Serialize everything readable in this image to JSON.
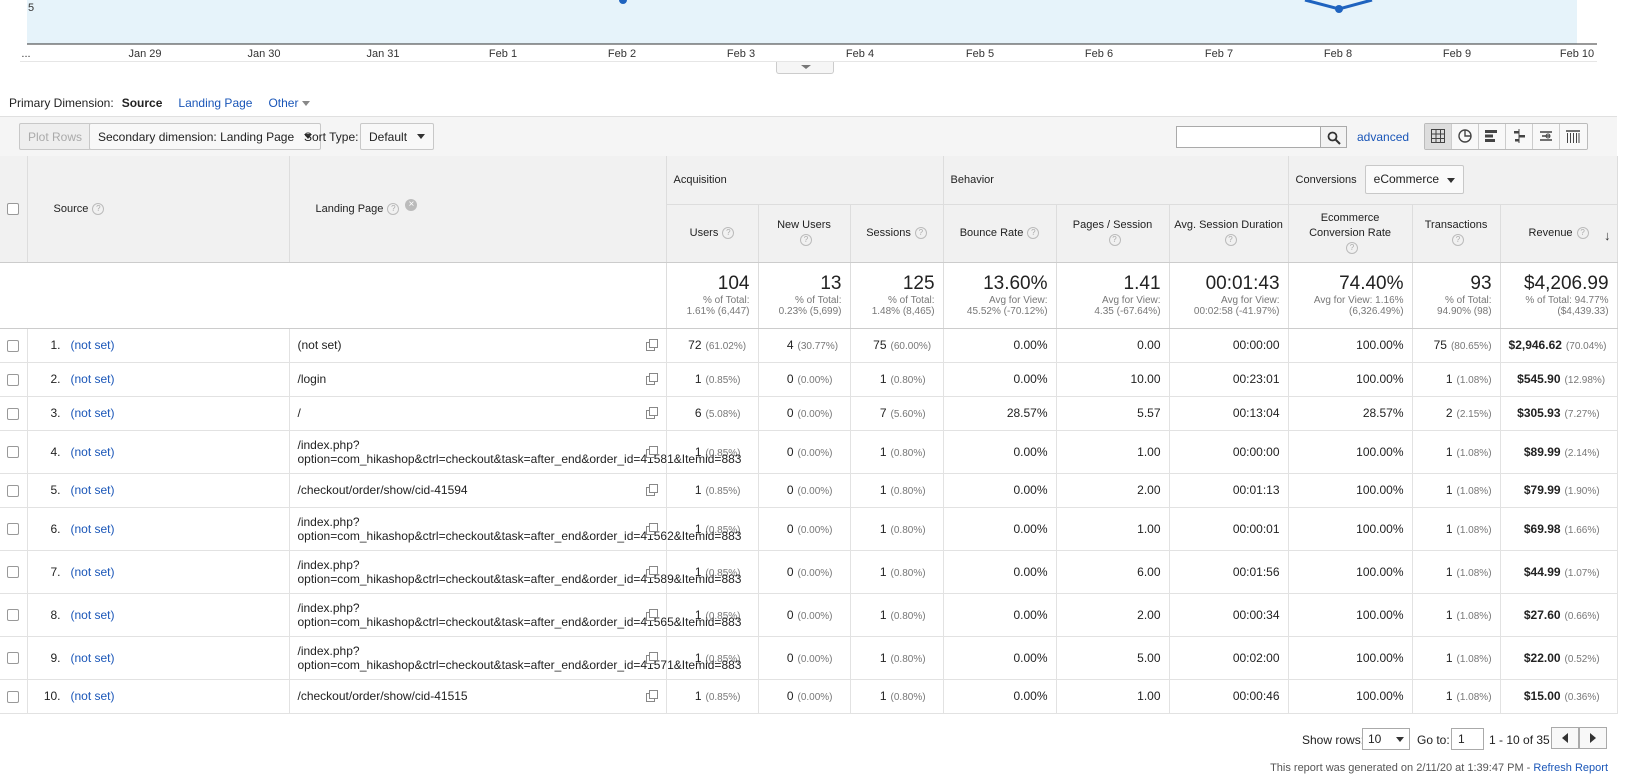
{
  "chart": {
    "y_tick": "5",
    "x_ticks": [
      "...",
      "Jan 29",
      "Jan 30",
      "Jan 31",
      "Feb 1",
      "Feb 2",
      "Feb 3",
      "Feb 4",
      "Feb 5",
      "Feb 6",
      "Feb 7",
      "Feb 8",
      "Feb 9",
      "Feb 10"
    ],
    "line_color": "#1f63bf",
    "fill_color": "#e6f3fa"
  },
  "primary_dimension": {
    "label": "Primary Dimension:",
    "active": "Source",
    "links": [
      "Landing Page",
      "Other"
    ]
  },
  "toolbar": {
    "plot_rows": "Plot Rows",
    "secondary_dimension": "Secondary dimension: Landing Page",
    "sort_type_label": "Sort Type:",
    "sort_type_value": "Default",
    "search_value": "",
    "advanced": "advanced"
  },
  "table": {
    "groups": {
      "acquisition": "Acquisition",
      "behavior": "Behavior",
      "conversions": "Conversions",
      "conversions_select": "eCommerce"
    },
    "columns": {
      "source": "Source",
      "landing_page": "Landing Page",
      "users": "Users",
      "new_users": "New Users",
      "sessions": "Sessions",
      "bounce_rate": "Bounce Rate",
      "pages_session": "Pages / Session",
      "avg_session_duration": "Avg. Session Duration",
      "ecommerce_conversion_rate": "Ecommerce Conversion Rate",
      "transactions": "Transactions",
      "revenue": "Revenue"
    },
    "totals": {
      "users": {
        "value": "104",
        "sub1": "% of Total:",
        "sub2": "1.61% (6,447)"
      },
      "new_users": {
        "value": "13",
        "sub1": "% of Total:",
        "sub2": "0.23% (5,699)"
      },
      "sessions": {
        "value": "125",
        "sub1": "% of Total:",
        "sub2": "1.48% (8,465)"
      },
      "bounce_rate": {
        "value": "13.60%",
        "sub1": "Avg for View:",
        "sub2": "45.52% (-70.12%)"
      },
      "pages_session": {
        "value": "1.41",
        "sub1": "Avg for View:",
        "sub2": "4.35 (-67.64%)"
      },
      "avg_session_duration": {
        "value": "00:01:43",
        "sub1": "Avg for View:",
        "sub2": "00:02:58 (-41.97%)"
      },
      "ecommerce_conversion_rate": {
        "value": "74.40%",
        "sub1": "Avg for View: 1.16%",
        "sub2": "(6,326.49%)"
      },
      "transactions": {
        "value": "93",
        "sub1": "% of Total:",
        "sub2": "94.90% (98)"
      },
      "revenue": {
        "value": "$4,206.99",
        "sub1": "% of Total: 94.77%",
        "sub2": "($4,439.33)"
      }
    },
    "rows": [
      {
        "index": "1.",
        "source": "(not set)",
        "landing_page": "(not set)",
        "users": "72",
        "users_pct": "(61.02%)",
        "new_users": "4",
        "new_users_pct": "(30.77%)",
        "sessions": "75",
        "sessions_pct": "(60.00%)",
        "bounce_rate": "0.00%",
        "pages_session": "0.00",
        "duration": "00:00:00",
        "conv_rate": "100.00%",
        "transactions": "75",
        "transactions_pct": "(80.65%)",
        "revenue": "$2,946.62",
        "revenue_pct": "(70.04%)"
      },
      {
        "index": "2.",
        "source": "(not set)",
        "landing_page": "/login",
        "users": "1",
        "users_pct": "(0.85%)",
        "new_users": "0",
        "new_users_pct": "(0.00%)",
        "sessions": "1",
        "sessions_pct": "(0.80%)",
        "bounce_rate": "0.00%",
        "pages_session": "10.00",
        "duration": "00:23:01",
        "conv_rate": "100.00%",
        "transactions": "1",
        "transactions_pct": "(1.08%)",
        "revenue": "$545.90",
        "revenue_pct": "(12.98%)"
      },
      {
        "index": "3.",
        "source": "(not set)",
        "landing_page": "/",
        "users": "6",
        "users_pct": "(5.08%)",
        "new_users": "0",
        "new_users_pct": "(0.00%)",
        "sessions": "7",
        "sessions_pct": "(5.60%)",
        "bounce_rate": "28.57%",
        "pages_session": "5.57",
        "duration": "00:13:04",
        "conv_rate": "28.57%",
        "transactions": "2",
        "transactions_pct": "(2.15%)",
        "revenue": "$305.93",
        "revenue_pct": "(7.27%)"
      },
      {
        "index": "4.",
        "source": "(not set)",
        "landing_page": "/index.php?option=com_hikashop&ctrl=checkout&task=after_end&order_id=41581&Itemid=883",
        "users": "1",
        "users_pct": "(0.85%)",
        "new_users": "0",
        "new_users_pct": "(0.00%)",
        "sessions": "1",
        "sessions_pct": "(0.80%)",
        "bounce_rate": "0.00%",
        "pages_session": "1.00",
        "duration": "00:00:00",
        "conv_rate": "100.00%",
        "transactions": "1",
        "transactions_pct": "(1.08%)",
        "revenue": "$89.99",
        "revenue_pct": "(2.14%)"
      },
      {
        "index": "5.",
        "source": "(not set)",
        "landing_page": "/checkout/order/show/cid-41594",
        "users": "1",
        "users_pct": "(0.85%)",
        "new_users": "0",
        "new_users_pct": "(0.00%)",
        "sessions": "1",
        "sessions_pct": "(0.80%)",
        "bounce_rate": "0.00%",
        "pages_session": "2.00",
        "duration": "00:01:13",
        "conv_rate": "100.00%",
        "transactions": "1",
        "transactions_pct": "(1.08%)",
        "revenue": "$79.99",
        "revenue_pct": "(1.90%)"
      },
      {
        "index": "6.",
        "source": "(not set)",
        "landing_page": "/index.php?option=com_hikashop&ctrl=checkout&task=after_end&order_id=41562&Itemid=883",
        "users": "1",
        "users_pct": "(0.85%)",
        "new_users": "0",
        "new_users_pct": "(0.00%)",
        "sessions": "1",
        "sessions_pct": "(0.80%)",
        "bounce_rate": "0.00%",
        "pages_session": "1.00",
        "duration": "00:00:01",
        "conv_rate": "100.00%",
        "transactions": "1",
        "transactions_pct": "(1.08%)",
        "revenue": "$69.98",
        "revenue_pct": "(1.66%)"
      },
      {
        "index": "7.",
        "source": "(not set)",
        "landing_page": "/index.php?option=com_hikashop&ctrl=checkout&task=after_end&order_id=41589&Itemid=883",
        "users": "1",
        "users_pct": "(0.85%)",
        "new_users": "0",
        "new_users_pct": "(0.00%)",
        "sessions": "1",
        "sessions_pct": "(0.80%)",
        "bounce_rate": "0.00%",
        "pages_session": "6.00",
        "duration": "00:01:56",
        "conv_rate": "100.00%",
        "transactions": "1",
        "transactions_pct": "(1.08%)",
        "revenue": "$44.99",
        "revenue_pct": "(1.07%)"
      },
      {
        "index": "8.",
        "source": "(not set)",
        "landing_page": "/index.php?option=com_hikashop&ctrl=checkout&task=after_end&order_id=41565&Itemid=883",
        "users": "1",
        "users_pct": "(0.85%)",
        "new_users": "0",
        "new_users_pct": "(0.00%)",
        "sessions": "1",
        "sessions_pct": "(0.80%)",
        "bounce_rate": "0.00%",
        "pages_session": "2.00",
        "duration": "00:00:34",
        "conv_rate": "100.00%",
        "transactions": "1",
        "transactions_pct": "(1.08%)",
        "revenue": "$27.60",
        "revenue_pct": "(0.66%)"
      },
      {
        "index": "9.",
        "source": "(not set)",
        "landing_page": "/index.php?option=com_hikashop&ctrl=checkout&task=after_end&order_id=41571&Itemid=883",
        "users": "1",
        "users_pct": "(0.85%)",
        "new_users": "0",
        "new_users_pct": "(0.00%)",
        "sessions": "1",
        "sessions_pct": "(0.80%)",
        "bounce_rate": "0.00%",
        "pages_session": "5.00",
        "duration": "00:02:00",
        "conv_rate": "100.00%",
        "transactions": "1",
        "transactions_pct": "(1.08%)",
        "revenue": "$22.00",
        "revenue_pct": "(0.52%)"
      },
      {
        "index": "10.",
        "source": "(not set)",
        "landing_page": "/checkout/order/show/cid-41515",
        "users": "1",
        "users_pct": "(0.85%)",
        "new_users": "0",
        "new_users_pct": "(0.00%)",
        "sessions": "1",
        "sessions_pct": "(0.80%)",
        "bounce_rate": "0.00%",
        "pages_session": "1.00",
        "duration": "00:00:46",
        "conv_rate": "100.00%",
        "transactions": "1",
        "transactions_pct": "(1.08%)",
        "revenue": "$15.00",
        "revenue_pct": "(0.36%)"
      }
    ]
  },
  "pager": {
    "show_rows_label": "Show rows:",
    "show_rows_value": "10",
    "goto_label": "Go to:",
    "goto_value": "1",
    "range": "1 - 10 of 35"
  },
  "footer": {
    "generated": "This report was generated on 2/11/20 at 1:39:47 PM - ",
    "refresh": "Refresh Report"
  }
}
